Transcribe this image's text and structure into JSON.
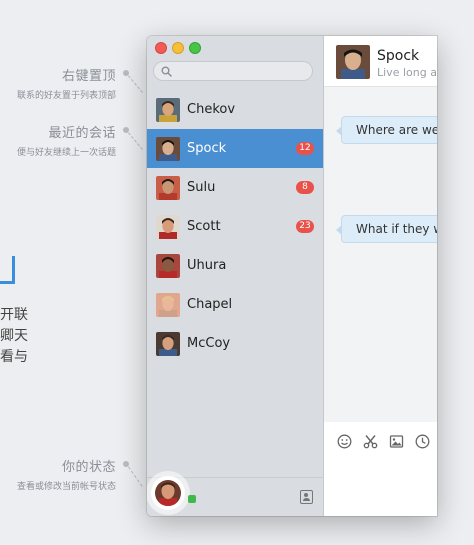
{
  "annotations": {
    "pin": {
      "title": "右键置顶",
      "subtitle": "联系的好友置于列表顶部"
    },
    "recent": {
      "title": "最近的会话",
      "subtitle": "便与好友继续上一次话题"
    },
    "status": {
      "title": "你的状态",
      "subtitle": "查看或修改当前帐号状态"
    }
  },
  "side_text": [
    "开联",
    "卿天",
    "看与"
  ],
  "search": {
    "placeholder": ""
  },
  "contacts": [
    {
      "name": "Chekov",
      "badge": "",
      "active": false,
      "skin": "#d9a67c",
      "hair": "#3a2a1c",
      "shirt": "#c9a23a",
      "bg": "#5a6b7a"
    },
    {
      "name": "Spock",
      "badge": "12",
      "active": true,
      "skin": "#d8b08e",
      "hair": "#141414",
      "shirt": "#3e5b8a",
      "bg": "#6b4c3a"
    },
    {
      "name": "Sulu",
      "badge": "8",
      "active": false,
      "skin": "#c79673",
      "hair": "#1d1a18",
      "shirt": "#b33a2c",
      "bg": "#c85e46"
    },
    {
      "name": "Scott",
      "badge": "23",
      "active": false,
      "skin": "#d99a78",
      "hair": "#3a2618",
      "shirt": "#b02a2a",
      "bg": "#dfd8cf"
    },
    {
      "name": "Uhura",
      "badge": "",
      "active": false,
      "skin": "#8a5a40",
      "hair": "#1a120c",
      "shirt": "#b62a2a",
      "bg": "#a8473d"
    },
    {
      "name": "Chapel",
      "badge": "",
      "active": false,
      "skin": "#eab79a",
      "hair": "#e2c58f",
      "shirt": "#cfa18a",
      "bg": "#e0a78e"
    },
    {
      "name": "McCoy",
      "badge": "",
      "active": false,
      "skin": "#d5a07e",
      "hair": "#3a2a20",
      "shirt": "#3e5b8a",
      "bg": "#4a3a32"
    }
  ],
  "chat": {
    "name": "Spock",
    "status": "Live long and prosper",
    "messages": [
      "Where are we going",
      "What if they were"
    ]
  },
  "toolbar": [
    "emoji-icon",
    "scissors-icon",
    "image-icon",
    "clock-icon"
  ],
  "colors": {
    "accent": "#4a8fd2",
    "badge": "#e9524a",
    "online": "#41b84b"
  }
}
